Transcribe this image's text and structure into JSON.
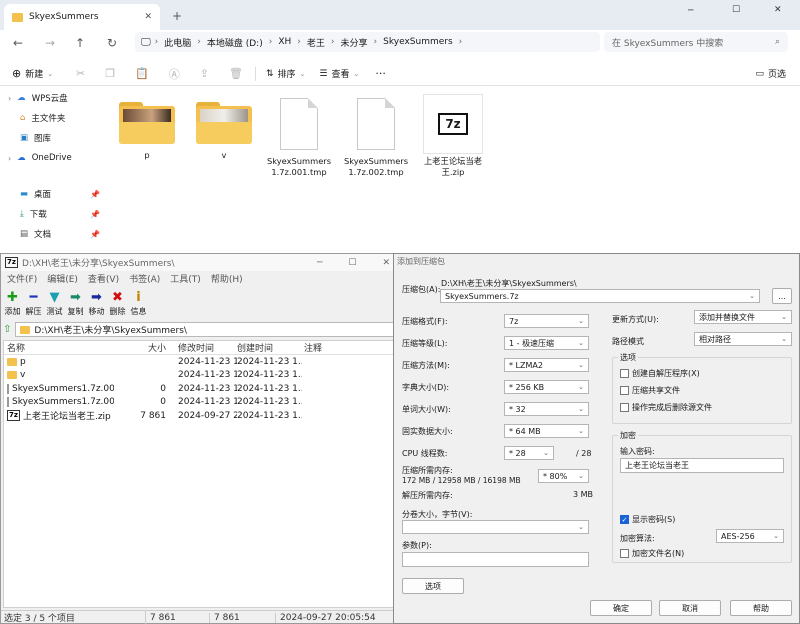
{
  "explorer": {
    "tab_title": "SkyexSummers",
    "breadcrumb": [
      "此电脑",
      "本地磁盘 (D:)",
      "XH",
      "老王",
      "未分享",
      "SkyexSummers"
    ],
    "search_placeholder": "在 SkyexSummers 中搜索",
    "commands": {
      "new": "新建",
      "sort": "排序",
      "view": "查看",
      "details": "页选"
    },
    "sidebar": [
      {
        "label": "WPS云盘",
        "icon": "cloud-icon"
      },
      {
        "label": "主文件夹",
        "icon": "home-icon"
      },
      {
        "label": "图库",
        "icon": "gallery-icon"
      },
      {
        "label": "OneDrive",
        "icon": "cloud-icon"
      },
      {
        "label": "桌面",
        "icon": "desktop-icon"
      },
      {
        "label": "下载",
        "icon": "download-icon"
      },
      {
        "label": "文档",
        "icon": "document-icon"
      }
    ],
    "files": [
      {
        "name": "p",
        "type": "folder"
      },
      {
        "name": "v",
        "type": "folder"
      },
      {
        "name": "SkyexSummers 1.7z.001.tmp",
        "type": "file"
      },
      {
        "name": "SkyexSummers 1.7z.002.tmp",
        "type": "file"
      },
      {
        "name": "上老王论坛当老 王.zip",
        "type": "zip"
      }
    ]
  },
  "fm": {
    "title": "D:\\XH\\老王\\未分享\\SkyexSummers\\",
    "menu": [
      "文件(F)",
      "编辑(E)",
      "查看(V)",
      "书签(A)",
      "工具(T)",
      "帮助(H)"
    ],
    "toolbar": [
      {
        "label": "添加",
        "glyph": "✚",
        "color": "#1a9e1a"
      },
      {
        "label": "解压",
        "glyph": "━",
        "color": "#2233bb"
      },
      {
        "label": "测试",
        "glyph": "▼",
        "color": "#1aa0b0"
      },
      {
        "label": "复制",
        "glyph": "➡",
        "color": "#1a8a6a"
      },
      {
        "label": "移动",
        "glyph": "➡",
        "color": "#1a2a9a"
      },
      {
        "label": "删除",
        "glyph": "✖",
        "color": "#d01010"
      },
      {
        "label": "信息",
        "glyph": "i",
        "color": "#c08000"
      }
    ],
    "path": "D:\\XH\\老王\\未分享\\SkyexSummers\\",
    "columns": [
      "名称",
      "大小",
      "修改时间",
      "创建时间",
      "注释"
    ],
    "rows": [
      {
        "name": "p",
        "size": "",
        "modified": "2024-11-23 1...",
        "created": "2024-11-23 1...",
        "type": "folder"
      },
      {
        "name": "v",
        "size": "",
        "modified": "2024-11-23 1...",
        "created": "2024-11-23 1...",
        "type": "folder"
      },
      {
        "name": "SkyexSummers1.7z.00...",
        "size": "0",
        "modified": "2024-11-23 1...",
        "created": "2024-11-23 1...",
        "type": "file"
      },
      {
        "name": "SkyexSummers1.7z.00...",
        "size": "0",
        "modified": "2024-11-23 1...",
        "created": "2024-11-23 1...",
        "type": "file"
      },
      {
        "name": "上老王论坛当老王.zip",
        "size": "7 861",
        "modified": "2024-09-27 2...",
        "created": "2024-11-23 1...",
        "type": "zip"
      }
    ],
    "status": {
      "selection": "选定 3 / 5 个项目",
      "size1": "7 861",
      "size2": "7 861",
      "date": "2024-09-27 20:05:54"
    }
  },
  "dlg": {
    "title": "添加到压缩包",
    "archive_label": "压缩包(A):",
    "archive_dir": "D:\\XH\\老王\\未分享\\SkyexSummers\\",
    "archive_name": "SkyexSummers.7z",
    "browse": "...",
    "left": [
      {
        "label": "压缩格式(F):",
        "value": "7z"
      },
      {
        "label": "压缩等级(L):",
        "value": "1 - 极速压缩"
      },
      {
        "label": "压缩方法(M):",
        "value": "* LZMA2"
      },
      {
        "label": "字典大小(D):",
        "value": "* 256 KB"
      },
      {
        "label": "单词大小(W):",
        "value": "* 32"
      },
      {
        "label": "固实数据大小:",
        "value": "* 64 MB"
      }
    ],
    "threads_label": "CPU 线程数:",
    "threads_value": "* 28",
    "threads_max": "/ 28",
    "mem_label": "压缩所需内存:",
    "mem_detail": "172 MB / 12958 MB / 16198 MB",
    "mem_pct": "* 80%",
    "decomp_label": "解压所需内存:",
    "decomp_value": "3 MB",
    "split_label": "分卷大小，字节(V):",
    "params_label": "参数(P):",
    "options_btn": "选项",
    "update_label": "更新方式(U):",
    "update_value": "添加并替换文件",
    "path_label": "路径模式",
    "path_value": "相对路径",
    "options_title": "选项",
    "options": [
      "创建自解压程序(X)",
      "压缩共享文件",
      "操作完成后删除源文件"
    ],
    "enc_title": "加密",
    "pwd_label": "输入密码:",
    "pwd_value": "上老王论坛当老王",
    "show_pwd": "显示密码(S)",
    "enc_method_label": "加密算法:",
    "enc_method": "AES-256",
    "enc_names": "加密文件名(N)",
    "buttons": {
      "ok": "确定",
      "cancel": "取消",
      "help": "帮助"
    }
  }
}
